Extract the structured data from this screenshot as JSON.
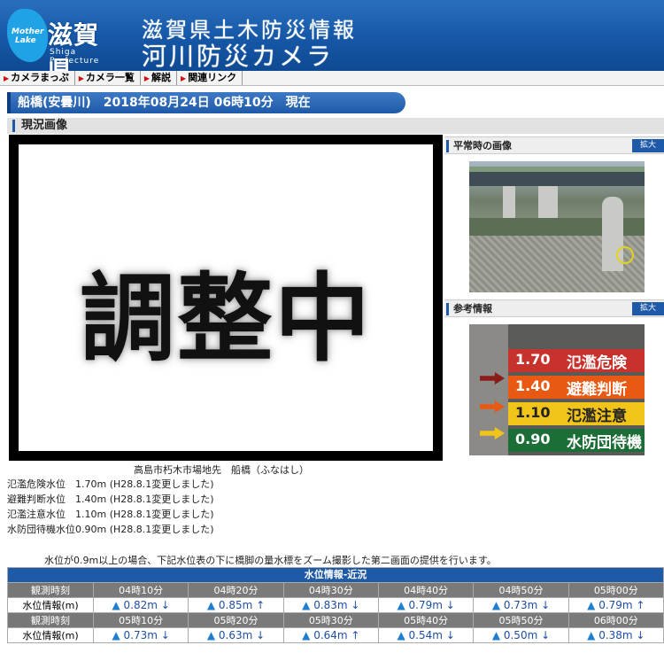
{
  "header": {
    "logo_main": "滋賀県",
    "logo_sub": "Shiga Prefecture",
    "logo_badge_1": "Mother",
    "logo_badge_2": "Lake",
    "title_line1": "滋賀県土木防災情報",
    "title_line2": "河川防災カメラ"
  },
  "nav": [
    "カメラまっぷ",
    "カメラ一覧",
    "解説",
    "関連リンク"
  ],
  "station_bar": "船橋(安曇川)　2018年08月24日 06時10分　現在",
  "section_title": "現況画像",
  "main_image_text": "調整中",
  "side": {
    "normal_title": "平常時の画像",
    "normal_btn": "拡大",
    "ref_title": "参考情報",
    "ref_btn": "拡大"
  },
  "levels_board": [
    {
      "value": "1.70",
      "label": "氾濫危険",
      "color": "#c8322c"
    },
    {
      "value": "1.40",
      "label": "避難判断",
      "color": "#e85a14"
    },
    {
      "value": "1.10",
      "label": "氾濫注意",
      "color": "#f0c419"
    },
    {
      "value": "0.90",
      "label": "水防団待機",
      "color": "#1a6e36"
    }
  ],
  "caption": "高島市朽木市場地先　船橋（ふなはし）",
  "info_lines": [
    "氾濫危険水位　1.70m (H28.8.1変更しました)",
    "避難判断水位　1.40m (H28.8.1変更しました)",
    "氾濫注意水位　1.10m (H28.8.1変更しました)",
    "水防団待機水位0.90m (H28.8.1変更しました)"
  ],
  "note": "水位が0.9m以上の場合、下記水位表の下に橋脚の量水標をズーム撮影した第二画面の提供を行います。",
  "table": {
    "caption": "水位情報-近況",
    "label_time": "観測時刻",
    "label_level": "水位情報(m)",
    "rows": [
      {
        "times": [
          "04時10分",
          "04時20分",
          "04時30分",
          "04時40分",
          "04時50分",
          "05時00分"
        ],
        "values": [
          "0.82m ↓",
          "0.85m ↑",
          "0.83m ↓",
          "0.79m ↓",
          "0.73m ↓",
          "0.79m ↑"
        ]
      },
      {
        "times": [
          "05時10分",
          "05時20分",
          "05時30分",
          "05時40分",
          "05時50分",
          "06時00分"
        ],
        "values": [
          "0.73m ↓",
          "0.63m ↓",
          "0.64m ↑",
          "0.54m ↓",
          "0.50m ↓",
          "0.38m ↓"
        ]
      }
    ]
  }
}
